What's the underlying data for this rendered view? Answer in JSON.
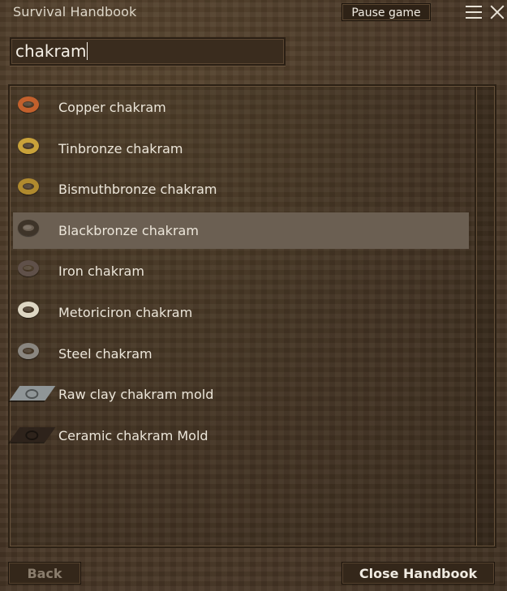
{
  "window": {
    "title": "Survival Handbook",
    "pause_label": "Pause game"
  },
  "search": {
    "value": "chakram"
  },
  "results": [
    {
      "label": "Copper chakram",
      "icon": "copper-chakram-icon",
      "color": "#c2602c",
      "selected": false
    },
    {
      "label": "Tinbronze chakram",
      "icon": "tinbronze-chakram-icon",
      "color": "#c9a23a",
      "selected": false
    },
    {
      "label": "Bismuthbronze chakram",
      "icon": "bismuthbronze-chakram-icon",
      "color": "#b08a2e",
      "selected": false
    },
    {
      "label": "Blackbronze chakram",
      "icon": "blackbronze-chakram-icon",
      "color": "#3e3429",
      "selected": true
    },
    {
      "label": "Iron chakram",
      "icon": "iron-chakram-icon",
      "color": "#5f5049",
      "selected": false
    },
    {
      "label": "Metoriciron chakram",
      "icon": "meteoriciron-chakram-icon",
      "color": "#ddd6c3",
      "selected": false
    },
    {
      "label": "Steel chakram",
      "icon": "steel-chakram-icon",
      "color": "#8a8680",
      "selected": false
    },
    {
      "label": "Raw clay chakram mold",
      "icon": "raw-clay-mold-icon",
      "color": "#8f9597",
      "selected": false
    },
    {
      "label": "Ceramic chakram Mold",
      "icon": "ceramic-mold-icon",
      "color": "#2e231b",
      "selected": false
    }
  ],
  "footer": {
    "back_label": "Back",
    "close_label": "Close Handbook"
  },
  "colors": {
    "background": "#4b3a28",
    "selected_row": "#6b5f52",
    "text": "#ece6da",
    "disabled_text": "#8a7d6d"
  }
}
